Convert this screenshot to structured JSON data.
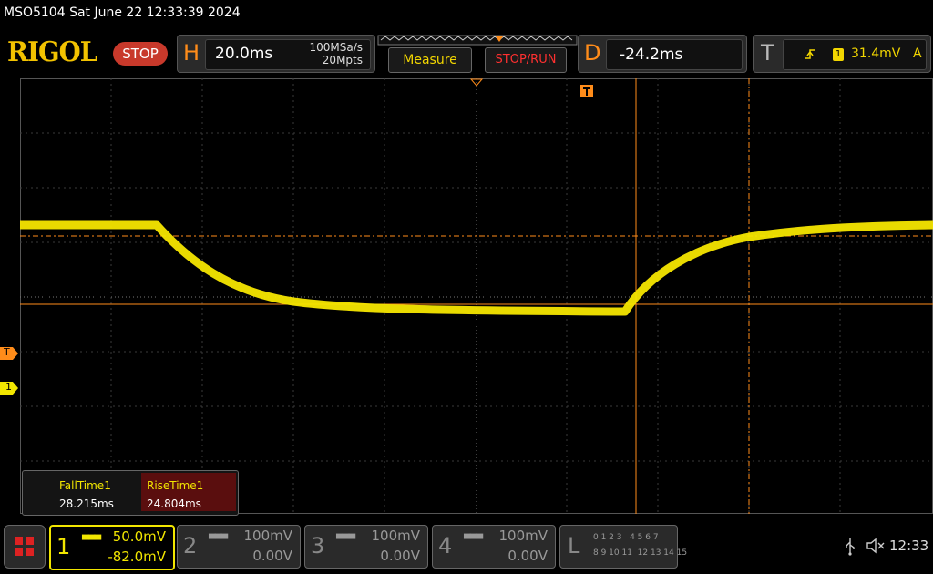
{
  "title": "MSO5104  Sat June 22 12:33:39 2024",
  "brand": "RIGOL",
  "run_state": "STOP",
  "horizontal": {
    "letter": "H",
    "timebase": "20.0ms",
    "sample_rate": "100MSa/s",
    "mem_depth": "20Mpts"
  },
  "buttons": {
    "measure": "Measure",
    "stop_run": "STOP/RUN"
  },
  "delay": {
    "letter": "D",
    "value": "-24.2ms"
  },
  "trigger": {
    "letter": "T",
    "source": "1",
    "level": "31.4mV",
    "mode": "A"
  },
  "markers": {
    "trigger": "T",
    "channel1": "1"
  },
  "measurements": [
    {
      "label": "FallTime1",
      "value": "28.215ms"
    },
    {
      "label": "RiseTime1",
      "value": "24.804ms"
    }
  ],
  "channels": [
    {
      "num": "1",
      "scale": "50.0mV",
      "offset": "-82.0mV",
      "active": true
    },
    {
      "num": "2",
      "scale": "100mV",
      "offset": "0.00V",
      "active": false
    },
    {
      "num": "3",
      "scale": "100mV",
      "offset": "0.00V",
      "active": false
    },
    {
      "num": "4",
      "scale": "100mV",
      "offset": "0.00V",
      "active": false
    }
  ],
  "logic": {
    "letter": "L",
    "row1": "0 1 2 3   4 5 6 7",
    "row2": "8 9 10 11  12 13 14 15"
  },
  "status": {
    "time": "12:33"
  },
  "colors": {
    "ch1": "#f2e600",
    "cursor": "#ff8c1a",
    "trigger": "#ff8c1a",
    "grid": "#444444",
    "stop": "#c8392b"
  },
  "icons": [
    "menu-icon",
    "usb-icon",
    "speaker-muted-icon",
    "trigger-edge-icon"
  ]
}
